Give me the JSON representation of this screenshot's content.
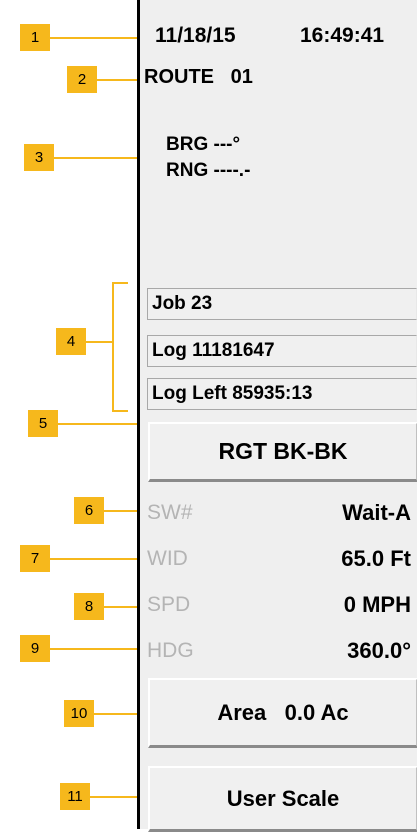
{
  "callouts": [
    "1",
    "2",
    "3",
    "4",
    "5",
    "6",
    "7",
    "8",
    "9",
    "10",
    "11"
  ],
  "header": {
    "date": "11/18/15",
    "time": "16:49:41",
    "route": "ROUTE   01"
  },
  "nav": {
    "brg": "BRG ---°",
    "rng": "RNG ----.-"
  },
  "fields": {
    "job": "Job 23",
    "log": "Log 11181647",
    "log_left": "Log Left 85935:13"
  },
  "direction_button": "RGT BK-BK",
  "readouts": [
    {
      "label": "SW#",
      "value": "Wait-A"
    },
    {
      "label": "WID",
      "value": "65.0 Ft"
    },
    {
      "label": "SPD",
      "value": "0 MPH"
    },
    {
      "label": "HDG",
      "value": "360.0°"
    }
  ],
  "area": {
    "label": "Area",
    "value": "0.0 Ac"
  },
  "user_scale_button": "User Scale",
  "colors": {
    "callout": "#f6b81c",
    "panel": "#efefef",
    "dim_label": "#b4b4b4"
  }
}
